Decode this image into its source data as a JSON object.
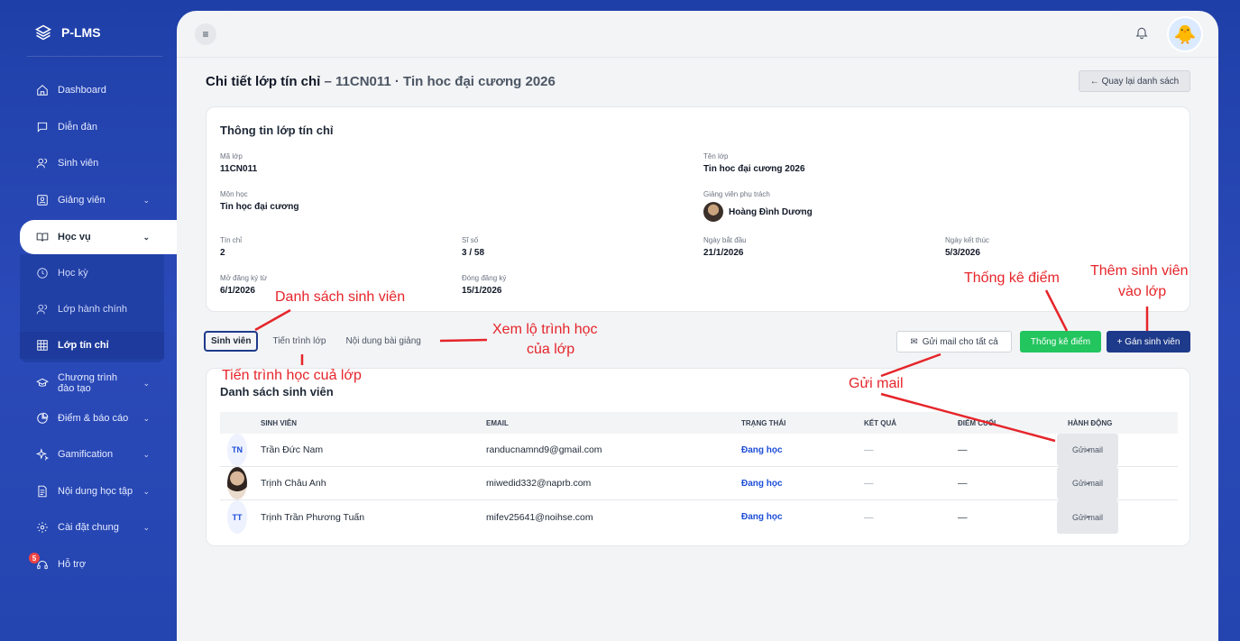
{
  "app": {
    "name": "P-LMS"
  },
  "sidebar": {
    "items": [
      {
        "label": "Dashboard",
        "icon": "home-icon"
      },
      {
        "label": "Diễn đàn",
        "icon": "chat-icon"
      },
      {
        "label": "Sinh viên",
        "icon": "users-icon"
      },
      {
        "label": "Giảng viên",
        "icon": "id-card-icon"
      },
      {
        "label": "Học vụ",
        "icon": "book-icon"
      },
      {
        "label": "Chương trình đào tạo",
        "icon": "graduation-cap-icon"
      },
      {
        "label": "Điểm & báo cáo",
        "icon": "pie-chart-icon"
      },
      {
        "label": "Gamification",
        "icon": "sparkle-icon"
      },
      {
        "label": "Nội dung học tập",
        "icon": "document-icon"
      },
      {
        "label": "Cài đặt chung",
        "icon": "gear-icon"
      },
      {
        "label": "Hỗ trợ",
        "icon": "headset-icon"
      }
    ],
    "submenu": [
      {
        "label": "Học kỳ",
        "icon": "clock-icon"
      },
      {
        "label": "Lớp hành chính",
        "icon": "users-icon"
      },
      {
        "label": "Lớp tín chỉ",
        "icon": "grid-icon"
      }
    ],
    "support_badge": "5"
  },
  "header": {
    "title": "Chi tiết lớp tín chỉ",
    "subtitle": "– 11CN011 · Tin hoc đại cương 2026",
    "back_label": "← Quay lại danh sách"
  },
  "info": {
    "title": "Thông tin lớp tín chỉ",
    "ma_lop_k": "Mã lớp",
    "ma_lop_v": "11CN011",
    "ten_lop_k": "Tên lớp",
    "ten_lop_v": "Tin hoc đại cương 2026",
    "mon_hoc_k": "Môn học",
    "mon_hoc_v": "Tin học đại cương",
    "gv_k": "Giảng viên phụ trách",
    "gv_v": "Hoàng Đình Dương",
    "tin_chi_k": "Tín chỉ",
    "tin_chi_v": "2",
    "si_so_k": "Sĩ số",
    "si_so_v": "3 / 58",
    "ngay_bd_k": "Ngày bắt đầu",
    "ngay_bd_v": "21/1/2026",
    "ngay_kt_k": "Ngày kết thúc",
    "ngay_kt_v": "5/3/2026",
    "mo_dk_k": "Mở đăng ký từ",
    "mo_dk_v": "6/1/2026",
    "dong_dk_k": "Đóng đăng ký",
    "dong_dk_v": "15/1/2026"
  },
  "tabs": [
    "Sinh viên",
    "Tiến trình lớp",
    "Nội dung bài giảng"
  ],
  "actions": {
    "mail_all": "Gửi mail cho tất cả",
    "stats": "Thống kê điểm",
    "add_student": "+ Gán sinh viên"
  },
  "students": {
    "title": "Danh sách sinh viên",
    "columns": [
      "SINH VIÊN",
      "EMAIL",
      "TRẠNG THÁI",
      "KẾT QUẢ",
      "ĐIỂM CUỐI",
      "HÀNH ĐỘNG"
    ],
    "rows": [
      {
        "initials": "TN",
        "name": "Trần Đức Nam",
        "email": "randucnamnd9@gmail.com",
        "status": "Đang học",
        "result": "—",
        "final": "—",
        "action": "Gửi mail"
      },
      {
        "initials": "",
        "name": "Trịnh Châu Anh",
        "email": "miwedid332@naprb.com",
        "status": "Đang học",
        "result": "—",
        "final": "—",
        "action": "Gửi mail"
      },
      {
        "initials": "TT",
        "name": "Trịnh Trần Phương Tuấn",
        "email": "mifev25641@noihse.com",
        "status": "Đang học",
        "result": "—",
        "final": "—",
        "action": "Gửi mail"
      }
    ]
  },
  "annotations": {
    "danh_sach": "Danh sách sinh viên",
    "xem_lo_trinh_1": "Xem lộ trình học",
    "xem_lo_trinh_2": "của lớp",
    "tien_trinh": "Tiến trình học cuả lớp",
    "thong_ke": "Thống kê điểm",
    "them_sv_1": "Thêm sinh viên",
    "them_sv_2": "vào lớp",
    "gui_mail": "Gửi mail"
  },
  "colors": {
    "sidebar_bg": "#2445b0",
    "primary": "#1e3a8a",
    "success": "#22c55e",
    "status_active": "#1d4ed8",
    "annotation": "#e5252a"
  }
}
